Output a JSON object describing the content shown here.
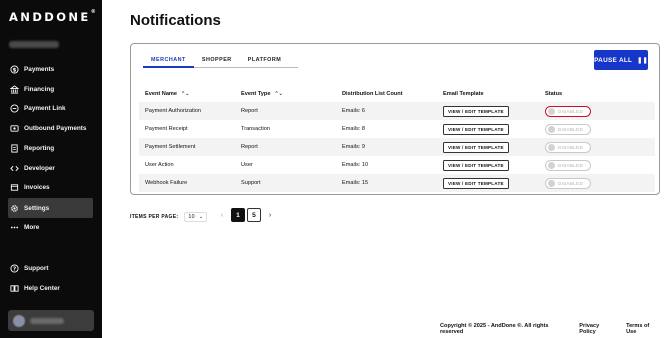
{
  "app": {
    "logo": "ANDDONE",
    "logo_mark": "®"
  },
  "sidebar": {
    "items": [
      {
        "label": "Payments",
        "icon": "dollar-circle-icon"
      },
      {
        "label": "Financing",
        "icon": "bank-icon"
      },
      {
        "label": "Payment Link",
        "icon": "link-icon"
      },
      {
        "label": "Outbound Payments",
        "icon": "outbound-icon"
      },
      {
        "label": "Reporting",
        "icon": "report-icon"
      },
      {
        "label": "Developer",
        "icon": "code-icon"
      },
      {
        "label": "Invoices",
        "icon": "invoice-icon"
      },
      {
        "label": "Settings",
        "icon": "gear-icon",
        "active": true
      },
      {
        "label": "More",
        "icon": "more-icon"
      }
    ],
    "bottom_items": [
      {
        "label": "Support",
        "icon": "question-icon"
      },
      {
        "label": "Help Center",
        "icon": "book-icon"
      }
    ]
  },
  "page": {
    "title": "Notifications"
  },
  "tabs": [
    {
      "label": "MERCHANT",
      "active": true
    },
    {
      "label": "SHOPPER",
      "active": false
    },
    {
      "label": "PLATFORM",
      "active": false
    }
  ],
  "pause_button": {
    "label": "PAUSE ALL",
    "icon": "pause-icon"
  },
  "table": {
    "headers": [
      "Event Name",
      "Event Type",
      "Distribution List Count",
      "Email Template",
      "Status"
    ],
    "rows": [
      {
        "event_name": "Payment Authorization",
        "event_type": "Report",
        "count": "Emails: 6",
        "template": "VIEW / EDIT TEMPLATE",
        "status": "DISABLED"
      },
      {
        "event_name": "Payment Receipt",
        "event_type": "Transaction",
        "count": "Emails: 8",
        "template": "VIEW / EDIT TEMPLATE",
        "status": "DISABLED"
      },
      {
        "event_name": "Payment Settlement",
        "event_type": "Report",
        "count": "Emails: 9",
        "template": "VIEW / EDIT TEMPLATE",
        "status": "DISABLED"
      },
      {
        "event_name": "User Action",
        "event_type": "User",
        "count": "Emails: 10",
        "template": "VIEW / EDIT TEMPLATE",
        "status": "DISABLED"
      },
      {
        "event_name": "Webhook Failure",
        "event_type": "Support",
        "count": "Emails: 15",
        "template": "VIEW / EDIT TEMPLATE",
        "status": "DISABLED"
      }
    ]
  },
  "pagination": {
    "items_per_page_label": "ITEMS PER PAGE:",
    "items_per_page_value": "10",
    "current_page": "1",
    "other_page": "5"
  },
  "footer": {
    "copyright": "Copyright © 2025 - AndDone ®. All rights reserved",
    "privacy": "Privacy Policy",
    "terms": "Terms of Use"
  },
  "colors": {
    "accent": "#1536c8",
    "sidebar_bg": "#0b0b0b",
    "highlight": "#c8102e"
  }
}
